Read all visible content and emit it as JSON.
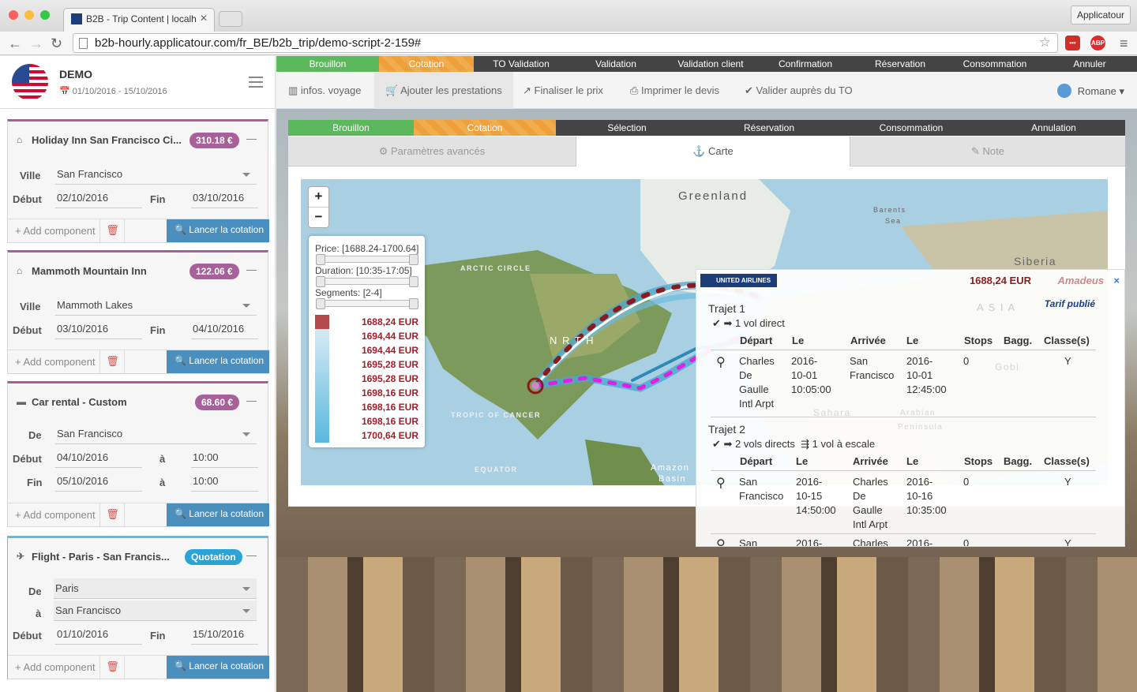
{
  "browser": {
    "tab_title": "B2B - Trip Content | localh",
    "url": "b2b-hourly.applicatour.com/fr_BE/b2b_trip/demo-script-2-159#",
    "profile_button": "Applicatour",
    "ext_lastpass": "•••",
    "ext_abp": "ABP"
  },
  "sidebar": {
    "title": "DEMO",
    "dates": "01/10/2016 - 15/10/2016",
    "common": {
      "add_component": "+ Add component",
      "launch": "Lancer la cotation"
    },
    "cards": [
      {
        "title": "Holiday Inn San Francisco Ci...",
        "price": "310.18 €",
        "l1": "Ville",
        "v1": "San Francisco",
        "l_start": "Début",
        "start": "02/10/2016",
        "l_end": "Fin",
        "end": "03/10/2016"
      },
      {
        "title": "Mammoth Mountain Inn",
        "price": "122.06 €",
        "l1": "Ville",
        "v1": "Mammoth Lakes",
        "l_start": "Début",
        "start": "03/10/2016",
        "l_end": "Fin",
        "end": "04/10/2016"
      },
      {
        "title": "Car rental - Custom",
        "price": "68.60 €",
        "l1": "De",
        "v1": "San Francisco",
        "l_start": "Début",
        "start": "04/10/2016",
        "l_a": "à",
        "t1": "10:00",
        "l_fin": "Fin",
        "end": "05/10/2016",
        "t2": "10:00"
      },
      {
        "title": "Flight - Paris - San Francis...",
        "price": "Quotation",
        "l1": "De",
        "v1": "Paris",
        "l_to": "à",
        "v2": "San Francisco",
        "l_start": "Début",
        "start": "01/10/2016",
        "l_end": "Fin",
        "end": "15/10/2016"
      }
    ]
  },
  "status_bar": [
    "Brouillon",
    "Cotation",
    "TO Validation",
    "Validation",
    "Validation client",
    "Confirmation",
    "Réservation",
    "Consommation",
    "Annuler"
  ],
  "top_nav": [
    "infos. voyage",
    "Ajouter les prestations",
    "Finaliser le prix",
    "Imprimer le devis",
    "Valider auprès du TO"
  ],
  "user": "Romane",
  "panel": {
    "status": [
      "Brouillon",
      "Cotation",
      "Sélection",
      "Réservation",
      "Consommation",
      "Annulation"
    ],
    "tabs": [
      "Paramètres avancés",
      "Carte",
      "Note"
    ]
  },
  "map": {
    "zoom_in": "+",
    "zoom_out": "−",
    "labels": {
      "greenland": "Greenland",
      "barents1": "Barents",
      "barents2": "Sea",
      "siberia": "Siberia",
      "asia": "A S I A",
      "arctic": "ARCTIC CIRCLE",
      "north": "N  R  T H",
      "tropic": "TROPIC OF CANCER",
      "equator": "EQUATOR",
      "amazon1": "Amazon",
      "amazon2": "Basin",
      "sahara": "Sahara",
      "arabian1": "Arabian",
      "arabian2": "Peninsula",
      "gobi": "Gobi"
    },
    "filter": {
      "price": "Price: [1688.24-1700.64]",
      "duration": "Duration: [10:35-17:05]",
      "segments": "Segments: [2-4]",
      "prices": [
        "1688,24 EUR",
        "1694,44 EUR",
        "1694,44 EUR",
        "1695,28 EUR",
        "1695,28 EUR",
        "1698,16 EUR",
        "1698,16 EUR",
        "1698,16 EUR",
        "1700,64 EUR"
      ]
    }
  },
  "popup": {
    "airline": "UNITED AIRLINES",
    "price": "1688,24 EUR",
    "provider": "Amadeus",
    "close": "×",
    "tarif": "Tarif publié",
    "trajet1": "Trajet 1",
    "t1_summary": "1 vol direct",
    "trajet2": "Trajet 2",
    "t2_summary_a": "2 vols directs",
    "t2_summary_b": "1 vol à escale",
    "headers": [
      "Départ",
      "Le",
      "Arrivée",
      "Le",
      "Stops",
      "Bagg.",
      "Classe(s)"
    ],
    "r1": {
      "dep": "Charles\nDe\nGaulle\nIntl Arpt",
      "le1": "2016-\n10-01\n10:05:00",
      "arr": "San\nFrancisco",
      "le2": "2016-\n10-01\n12:45:00",
      "stops": "0",
      "cls": "Y"
    },
    "r2": {
      "dep": "San\nFrancisco",
      "le1": "2016-\n10-15\n14:50:00",
      "arr": "Charles\nDe\nGaulle\nIntl Arpt",
      "le2": "2016-\n10-16\n10:35:00",
      "stops": "0",
      "cls": "Y"
    },
    "r3": {
      "dep": "San",
      "le1": "2016-",
      "arr": "Charles",
      "le2": "2016-",
      "stops": "0",
      "cls": "Y"
    }
  }
}
